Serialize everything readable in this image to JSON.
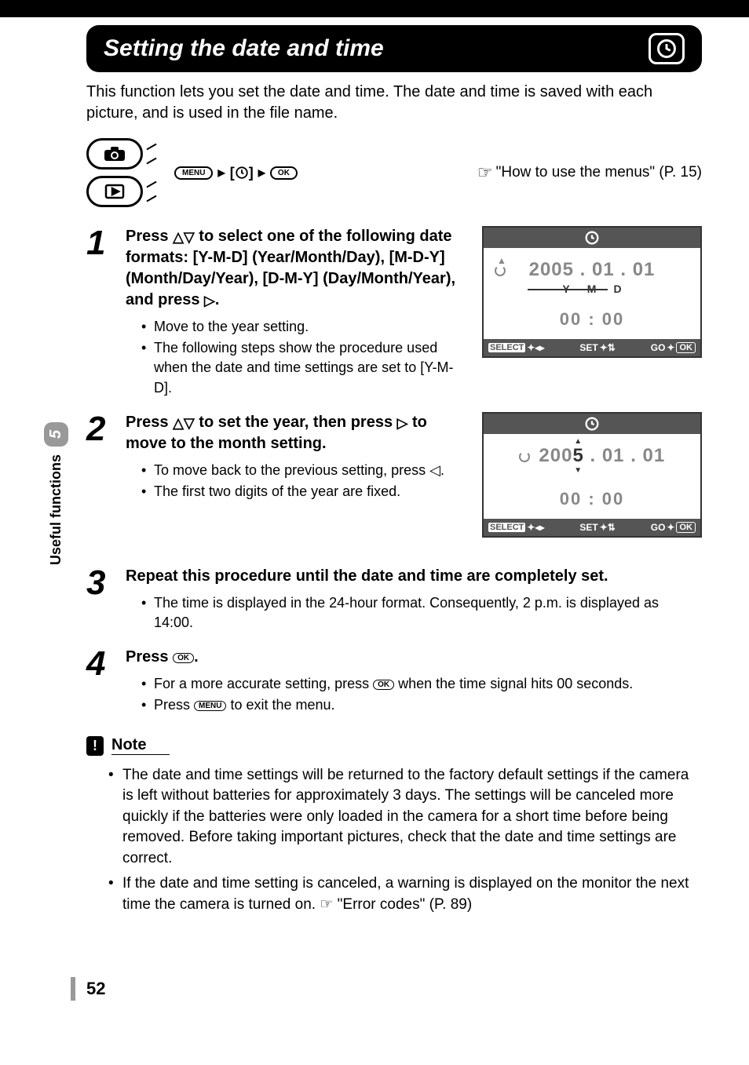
{
  "header": {
    "title": "Setting the date and time"
  },
  "intro": "This function lets you set the date and time. The date and time is saved with each picture, and is used in the file name.",
  "breadcrumb": {
    "menu": "MENU",
    "ok": "OK"
  },
  "ref": "\"How to use the menus\" (P. 15)",
  "steps": [
    {
      "num": "1",
      "title_parts": {
        "a": "Press ",
        "b": " to select one of the following date formats: [Y-M-D] (Year/Month/Day), [M-D-Y] (Month/Day/Year), [D-M-Y] (Day/Month/Year), and press ",
        "c": "."
      },
      "bullets": [
        "Move to the year setting.",
        "The following steps show the procedure used when the date and time settings are set to [Y-M-D]."
      ]
    },
    {
      "num": "2",
      "title_parts": {
        "a": "Press ",
        "b": " to set the year, then press ",
        "c": " to move to the month setting."
      },
      "bullets": [
        "To move back to the previous setting, press ◁.",
        "The first two digits of the year are fixed."
      ]
    },
    {
      "num": "3",
      "title": "Repeat this procedure until the date and time are completely set.",
      "bullets": [
        "The time is displayed in the 24-hour format. Consequently, 2 p.m. is displayed as 14:00."
      ]
    },
    {
      "num": "4",
      "title_parts": {
        "a": "Press ",
        "b": "."
      },
      "bullets": [
        "For a more accurate setting, press OK when the time signal hits 00 seconds.",
        "Press MENU to exit the menu."
      ]
    }
  ],
  "lcd1": {
    "date": "2005 . 01 . 01",
    "y": "Y",
    "m": "M",
    "d": "D",
    "time": "00 : 00",
    "select": "SELECT",
    "set": "SET",
    "go": "GO",
    "ok": "OK"
  },
  "lcd2": {
    "date_prefix": "200",
    "date_digit": "5",
    "date_suffix": " . 01 . 01",
    "time": "00 : 00",
    "select": "SELECT",
    "set": "SET",
    "go": "GO",
    "ok": "OK"
  },
  "note": {
    "title": "Note",
    "items": [
      "The date and time settings will be returned to the factory default settings if the camera is left without batteries for approximately 3 days. The settings will be canceled more quickly if the batteries were only loaded in the camera for a short time before being removed. Before taking important pictures, check that the date and time settings are correct.",
      "If the date and time setting is canceled, a warning is displayed on the monitor the next time the camera is turned on. ☞ \"Error codes\" (P. 89)"
    ]
  },
  "side": {
    "chapter": "5",
    "label": "Useful functions"
  },
  "page_number": "52"
}
